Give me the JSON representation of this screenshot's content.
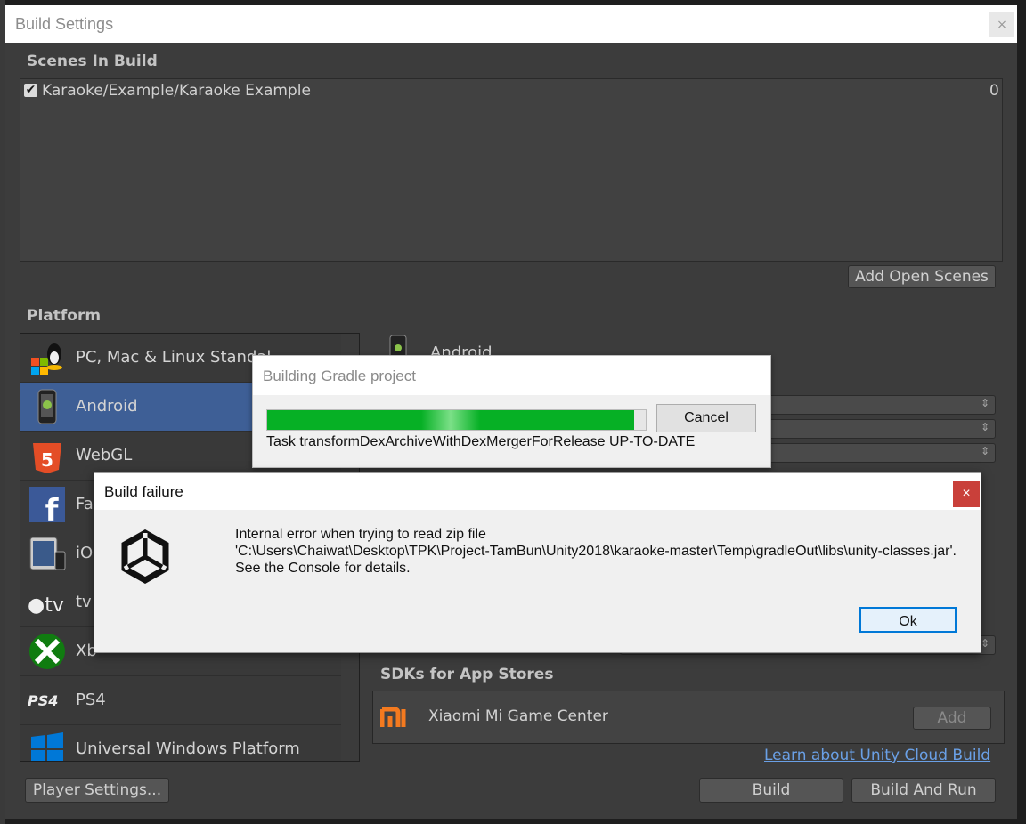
{
  "build_settings": {
    "title": "Build Settings",
    "close_label": "×",
    "scenes_header": "Scenes In Build",
    "scenes": [
      {
        "path": "Karaoke/Example/Karaoke Example",
        "index": "0",
        "checked": true
      }
    ],
    "add_open_scenes": "Add Open Scenes",
    "platform_header": "Platform",
    "platforms": [
      {
        "label": "PC, Mac & Linux Standal",
        "icon": "pc-mac-linux-icon"
      },
      {
        "label": "Android",
        "icon": "android-icon",
        "selected": true
      },
      {
        "label": "WebGL",
        "icon": "html5-icon"
      },
      {
        "label": "Fa",
        "icon": "facebook-icon"
      },
      {
        "label": "iO",
        "icon": "ios-icon"
      },
      {
        "label": "tv",
        "icon": "apple-tv-icon"
      },
      {
        "label": "Xb",
        "icon": "xbox-icon"
      },
      {
        "label": "PS4",
        "icon": "ps4-icon"
      },
      {
        "label": "Universal Windows Platform",
        "icon": "windows-icon"
      }
    ],
    "selected_platform_label": "Android",
    "sdks_header": "SDKs for App Stores",
    "sdk_item": "Xiaomi Mi Game Center",
    "sdk_add": "Add",
    "cloud_link": "Learn about Unity Cloud Build",
    "player_settings": "Player Settings...",
    "build": "Build",
    "build_and_run": "Build And Run"
  },
  "gradle_dialog": {
    "title": "Building Gradle project",
    "progress": 0.97,
    "cancel": "Cancel",
    "task": "Task transformDexArchiveWithDexMergerForRelease UP-TO-DATE"
  },
  "failure_dialog": {
    "title": "Build failure",
    "close_label": "×",
    "message_line1": "Internal error when trying to read zip file",
    "message_line2": "'C:\\Users\\Chaiwat\\Desktop\\TPK\\Project-TamBun\\Unity2018\\karaoke-master\\Temp\\gradleOut\\libs\\unity-classes.jar'.",
    "message_line3": "See the Console for details.",
    "ok": "Ok"
  },
  "colors": {
    "window_bg": "#3c3c3c",
    "selection": "#3e5f96",
    "progress_green": "#06b025",
    "link": "#6aa0e6",
    "close_red": "#c9403a"
  }
}
